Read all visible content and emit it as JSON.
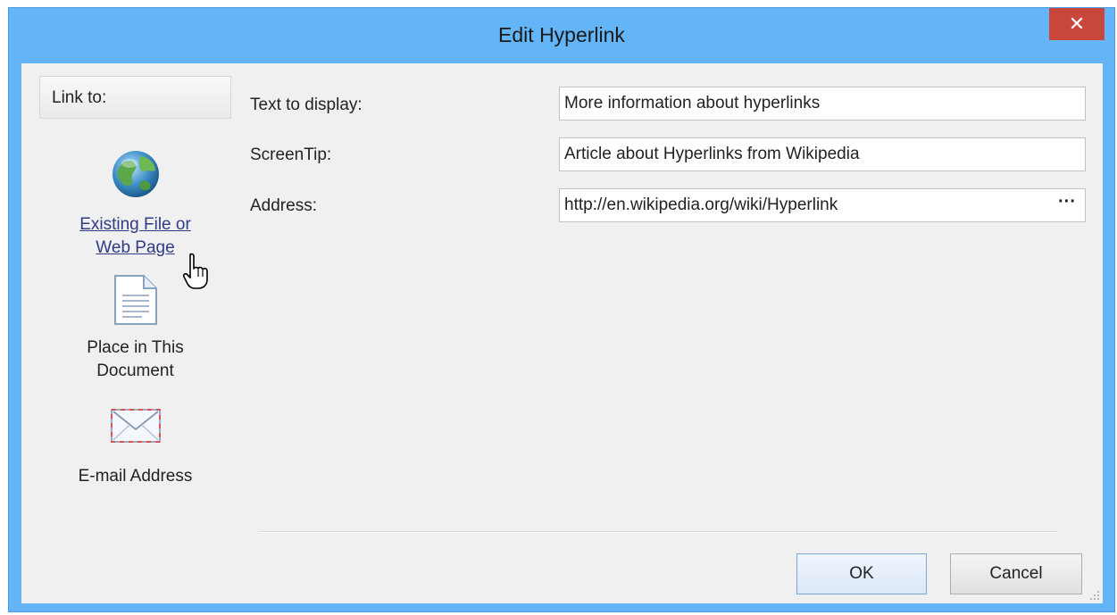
{
  "window": {
    "title": "Edit Hyperlink",
    "close_symbol": "✕"
  },
  "sidebar": {
    "header": "Link to:",
    "items": [
      {
        "label_line1": "Existing File or",
        "label_line2": "Web Page",
        "icon": "globe-icon",
        "active": true
      },
      {
        "label_line1": "Place in This",
        "label_line2": "Document",
        "icon": "document-icon",
        "active": false
      },
      {
        "label_line1": "E-mail Address",
        "label_line2": "",
        "icon": "envelope-icon",
        "active": false
      }
    ]
  },
  "fields": {
    "text_to_display": {
      "label": "Text to display:",
      "value": "More information about hyperlinks"
    },
    "screentip": {
      "label": "ScreenTip:",
      "value": "Article about Hyperlinks from Wikipedia"
    },
    "address": {
      "label": "Address:",
      "value": "http://en.wikipedia.org/wiki/Hyperlink",
      "browse_label": "···"
    }
  },
  "buttons": {
    "ok": "OK",
    "cancel": "Cancel"
  },
  "colors": {
    "titlebar": "#63b5f7",
    "close": "#c9463d",
    "active_link": "#2f3c85"
  }
}
